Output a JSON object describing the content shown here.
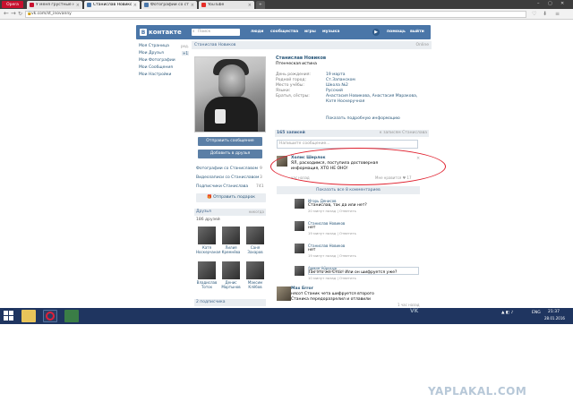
{
  "browser": {
    "menu_label": "Opera",
    "tabs": [
      {
        "title": "У меня грустные новост",
        "color": "#c8102e"
      },
      {
        "title": "Станислав Новиков",
        "color": "#4a76a8",
        "active": true
      },
      {
        "title": "Фотографии со страниц",
        "color": "#4a76a8"
      },
      {
        "title": "YouTube",
        "color": "#e52d27"
      }
    ],
    "url": "vk.com/st_inovanny"
  },
  "vk_header": {
    "logo_text": "контакте",
    "logo_letter": "В",
    "search_placeholder": "Поиск",
    "nav": [
      "люди",
      "сообщества",
      "игры",
      "музыка",
      "помощь",
      "выйти"
    ]
  },
  "left_menu": {
    "items": [
      {
        "label": "Моя Страница",
        "extra": "ред."
      },
      {
        "label": "Мои Друзья",
        "extra": "+1"
      },
      {
        "label": "Мои Фотографии",
        "extra": ""
      },
      {
        "label": "Мои Сообщения",
        "extra": ""
      },
      {
        "label": "Мои Настройки",
        "extra": ""
      }
    ]
  },
  "profile": {
    "bar_title": "Станислав Новиков",
    "bar_right": "Online",
    "name": "Станислав Новиков",
    "status": "Птенческая истина",
    "info": [
      {
        "key": "День рождения:",
        "value": "19 марта"
      },
      {
        "key": "Родной город:",
        "value": "Ст.Запанском"
      },
      {
        "key": "Место учёбы:",
        "value": "Школа №2"
      },
      {
        "key": "Языки:",
        "value": "Русский"
      },
      {
        "key": "Братья, сёстры:",
        "value": "Анастасия Новикова, Анастасия Маракова, Катя Носкеручная"
      }
    ],
    "show_more": "Показать подробную информацию",
    "buttons": {
      "message": "Отправить сообщение",
      "add_friend": "Добавить в друзья"
    },
    "side_links": [
      {
        "label": "Фотографии со Станиславом",
        "count": "9"
      },
      {
        "label": "Видеозаписи со Станиславом",
        "count": "3"
      },
      {
        "label": "Подписчики Станислава",
        "count": "741"
      }
    ],
    "gift_button": "Отправить подарок",
    "friends_header": "Друзья",
    "friends_all": "никогда",
    "friends_count": "186 друзей",
    "friends": [
      {
        "name": "Катя Носкерчаная"
      },
      {
        "name": "Лилия Кремнёва"
      },
      {
        "name": "Саня Захаров"
      },
      {
        "name": "Владислав Тотох"
      },
      {
        "name": "Денис Мартынов"
      },
      {
        "name": "Максим Клёбов"
      }
    ],
    "subscriptions": "2 подписчика"
  },
  "wall": {
    "header": "165 записей",
    "header_right": "к записям Станислава",
    "input_placeholder": "Напишите сообщение...",
    "main_post": {
      "author": "Холис Шерлок",
      "text": "ЯЛ, расходимся, поступила достоверная информация, ХТО НЕ ОНО!",
      "time": "час назад",
      "likes": "Мне нравится ♥ 17"
    },
    "show_all": "Показать все 8 комментариев",
    "comments": [
      {
        "author": "Игорь Денисов",
        "text": "Станислав, так да или нет?",
        "time": "20 минут назад | Ответить"
      },
      {
        "author": "Станислав Новиков",
        "text": "нет",
        "time": "19 минут назад | Ответить"
      },
      {
        "author": "Станислав Новиков",
        "text": "нет",
        "time": "19 минут назад | Ответить"
      },
      {
        "author": "Арман Абросов",
        "text": "Так это же Стас! Или он шифруется уже?",
        "time": "10 минут назад | Ответить"
      }
    ],
    "comment_placeholder": "Комментировать...",
    "second_post": {
      "author": "Max Error",
      "text": "нясот Станик чета шифруется второго Станика передоразрелил и отлавили",
      "time": "1 час назад"
    }
  },
  "taskbar": {
    "lang": "ENG",
    "time": "21:37",
    "date": "28.01.2016",
    "vk_mark": "VK"
  },
  "watermark": "YAPLAKAL.COM"
}
